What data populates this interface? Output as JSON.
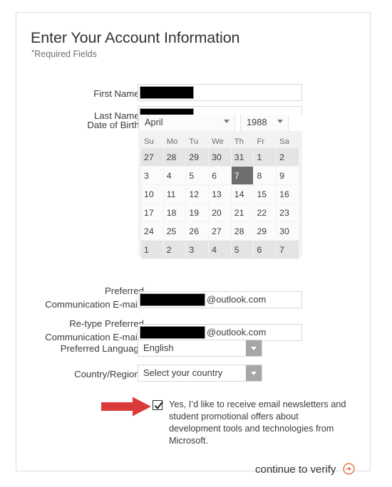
{
  "form": {
    "title": "Enter Your Account Information",
    "required_note": "Required Fields",
    "required_marker": "*",
    "fields": {
      "first_name": {
        "label": "First Name",
        "value": "",
        "redacted": true
      },
      "last_name": {
        "label": "Last Name",
        "value": "",
        "redacted": true
      },
      "date_of_birth": {
        "label": "Date of Birth",
        "month": "April",
        "year": "1988",
        "selected_day": "7",
        "weekdays": [
          "Su",
          "Mo",
          "Tu",
          "We",
          "Th",
          "Fr",
          "Sa"
        ],
        "weeks": [
          [
            {
              "d": "27",
              "adj": true
            },
            {
              "d": "28",
              "adj": true
            },
            {
              "d": "29",
              "adj": true
            },
            {
              "d": "30",
              "adj": true
            },
            {
              "d": "31",
              "adj": true
            },
            {
              "d": "1",
              "adj": true
            },
            {
              "d": "2",
              "adj": true
            }
          ],
          [
            {
              "d": "3"
            },
            {
              "d": "4"
            },
            {
              "d": "5"
            },
            {
              "d": "6"
            },
            {
              "d": "7",
              "selected": true
            },
            {
              "d": "8"
            },
            {
              "d": "9"
            }
          ],
          [
            {
              "d": "10"
            },
            {
              "d": "11"
            },
            {
              "d": "12"
            },
            {
              "d": "13"
            },
            {
              "d": "14"
            },
            {
              "d": "15"
            },
            {
              "d": "16"
            }
          ],
          [
            {
              "d": "17"
            },
            {
              "d": "18"
            },
            {
              "d": "19"
            },
            {
              "d": "20"
            },
            {
              "d": "21"
            },
            {
              "d": "22"
            },
            {
              "d": "23"
            }
          ],
          [
            {
              "d": "24"
            },
            {
              "d": "25"
            },
            {
              "d": "26"
            },
            {
              "d": "27"
            },
            {
              "d": "28"
            },
            {
              "d": "29"
            },
            {
              "d": "30"
            }
          ],
          [
            {
              "d": "1",
              "adj": true
            },
            {
              "d": "2",
              "adj": true
            },
            {
              "d": "3",
              "adj": true
            },
            {
              "d": "4",
              "adj": true
            },
            {
              "d": "5",
              "adj": true
            },
            {
              "d": "6",
              "adj": true
            },
            {
              "d": "7",
              "adj": true
            }
          ]
        ]
      },
      "email": {
        "label_line1": "Preferred",
        "label_line2": "Communication E-mail",
        "value": "",
        "redacted": true,
        "suffix": "@outlook.com"
      },
      "email_retype": {
        "label_line1": "Re-type Preferred",
        "label_line2": "Communication E-mail",
        "value": "",
        "redacted": true,
        "suffix": "@outlook.com"
      },
      "preferred_language": {
        "label": "Preferred Language",
        "value": "English"
      },
      "country_region": {
        "label": "Country/Region",
        "value": "Select your country"
      }
    },
    "newsletter_optin": {
      "checked": true,
      "text": "Yes, I’d like to receive email newsletters and student promotional offers about development tools and technologies from Microsoft."
    },
    "submit": {
      "label": "continue to verify",
      "icon": "circle-arrow-right-icon"
    }
  },
  "annotation": {
    "arrow_color": "#d93c38",
    "points_to": "newsletter-optin-checkbox"
  },
  "colors": {
    "accent_orange": "#e05a25",
    "panel_bg": "#f2f2f2",
    "adjacent_day_bg": "#e4e4e4",
    "selected_day_bg": "#6e6e6e",
    "dropdown_button": "#a6a6a6",
    "border": "#dcdcdc"
  }
}
